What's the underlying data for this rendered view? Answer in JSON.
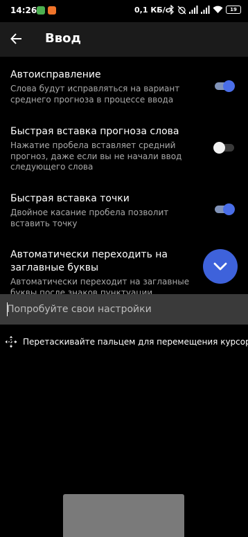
{
  "status_bar": {
    "time": "14:26",
    "network_speed": "0,1 КБ/с",
    "battery_level": "19",
    "app_icon_colors": [
      "#4caf50",
      "#f0742a"
    ],
    "icons": [
      "bluetooth-icon",
      "alarm-off-icon",
      "signal-icon",
      "signal-icon",
      "wifi-icon",
      "battery-icon"
    ]
  },
  "app_bar": {
    "back_icon": "arrow-left-icon",
    "title": "Ввод"
  },
  "settings": [
    {
      "title": "Автоисправление",
      "description": "Слова будут исправляться на вариант среднего прогноза в процессе ввода",
      "enabled": true
    },
    {
      "title": "Быстрая вставка прогноза слова",
      "description": "Нажатие пробела вставляет средний прогноз, даже если вы не начали ввод следующего слова",
      "enabled": false
    },
    {
      "title": "Быстрая вставка точки",
      "description": "Двойное касание пробела позволит вставить точку",
      "enabled": true
    },
    {
      "title": "Автоматически переходить на заглавные буквы",
      "description": "Автоматически переходит на заглавные буквы после знаков пунктуации",
      "enabled": true
    }
  ],
  "fab": {
    "icon": "chevron-down-icon"
  },
  "test_input": {
    "placeholder": "Попробуйте свои настройки",
    "value": ""
  },
  "cursor_hint": {
    "icon": "move-arrows-icon",
    "text": "Перетаскивайте пальцем для перемещения курсора"
  },
  "colors": {
    "background": "#000000",
    "accent": "#3e62db",
    "app_bar": "#1b1b1b",
    "description_text": "#a9a9a9",
    "input_bar": "#3a3a3a",
    "trackpad": "#7a7a7a"
  }
}
